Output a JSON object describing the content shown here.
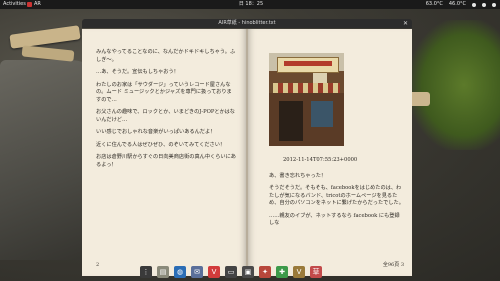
{
  "topbar": {
    "activities": "Activities",
    "app_name": "AR",
    "clock": "日 18：25",
    "status": [
      "63.0°C",
      "46.0°C"
    ]
  },
  "window": {
    "title": "AIR草紙 - hinoblitter.txt",
    "close_glyph": "✕"
  },
  "left_page": {
    "paragraphs": [
      "みんなやってることなのに、なんだかドキドキしちゃう。ふしぎ〜。",
      "…あ、そうだ。宣伝もしちゃおう！",
      "わたしのお家は「サウダージ」っていうレコード屋さんなの。ムード ミュージックとかジャズを専門に扱っておりますので…",
      "お父さんの趣味で、ロックとか、いまどきのJ-POPとかはないんだけど…",
      "いい感じでおしゃれな音楽がいっぱいあるんだよ！",
      "近くに住んでる人はぜひぜひ、のぞいてみてください！",
      "お店は倉野川駅からすぐの日向美商店街の真ん中くらいにあるよっ！"
    ],
    "page_number": "2"
  },
  "right_page": {
    "date": "2012-11-14T07:55:23+0000",
    "paragraphs": [
      "あ、書き忘れちゃった！",
      "そうだそうだ。そもそも、facebookをはじめたのは、わたしが気になるバンド、tricotのホームページを見るため、自分のパソコンをネットに繋げたからだったでした。",
      "……親友のイブが、ネットするなら facebook にも登録しな"
    ],
    "page_number": "3",
    "page_label": "全96頁"
  },
  "photo_icon": "shop-photo",
  "dock": {
    "items": [
      {
        "name": "grid-apps-icon",
        "glyph": "⋮",
        "color": "#3a3a3a"
      },
      {
        "name": "files-icon",
        "glyph": "▤",
        "color": "#8a8a7a"
      },
      {
        "name": "browser-icon",
        "glyph": "◍",
        "color": "#2a6db5"
      },
      {
        "name": "mail-icon",
        "glyph": "✉",
        "color": "#5a6f9a"
      },
      {
        "name": "vivaldi-icon",
        "glyph": "V",
        "color": "#d23b3b"
      },
      {
        "name": "terminal-icon",
        "glyph": "▭",
        "color": "#444444"
      },
      {
        "name": "media-icon",
        "glyph": "▣",
        "color": "#4a4a4a"
      },
      {
        "name": "palette-icon",
        "glyph": "✦",
        "color": "#b8473b"
      },
      {
        "name": "tools-icon",
        "glyph": "✚",
        "color": "#3d9a4a"
      },
      {
        "name": "vivaldi-snapshot-icon",
        "glyph": "V",
        "color": "#9a7a3a"
      },
      {
        "name": "reader-icon",
        "glyph": "草",
        "color": "#c24a4a"
      }
    ]
  }
}
